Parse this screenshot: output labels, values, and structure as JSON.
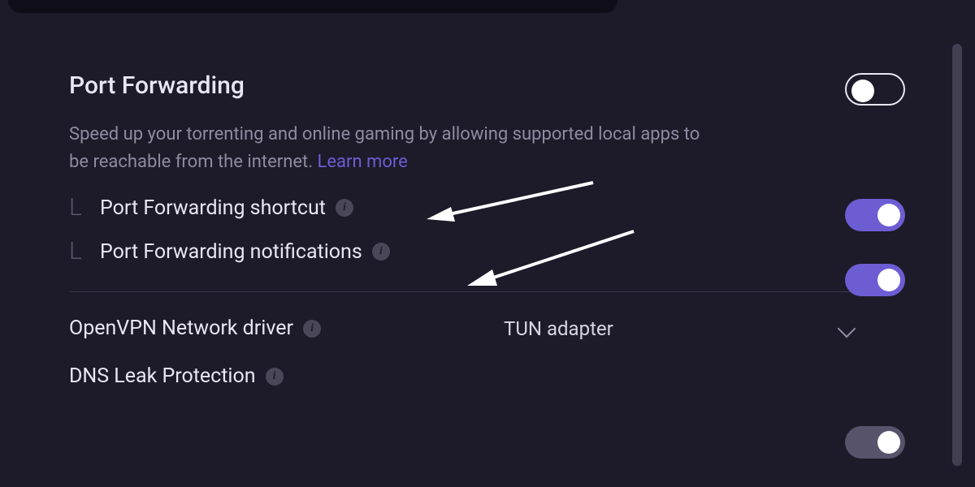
{
  "port_forwarding": {
    "title": "Port Forwarding",
    "description": "Speed up your torrenting and online gaming by allowing supported local apps to be reachable from the internet.",
    "learn_more": "Learn more",
    "toggle_on": false,
    "sub": {
      "shortcut": {
        "label": "Port Forwarding shortcut",
        "toggle_on": true
      },
      "notifications": {
        "label": "Port Forwarding notifications",
        "toggle_on": true
      }
    }
  },
  "openvpn_driver": {
    "label": "OpenVPN Network driver",
    "selected": "TUN adapter"
  },
  "dns_leak": {
    "label": "DNS Leak Protection",
    "toggle_on": true
  },
  "colors": {
    "accent": "#6c5dd3",
    "bg": "#1d1a29"
  }
}
